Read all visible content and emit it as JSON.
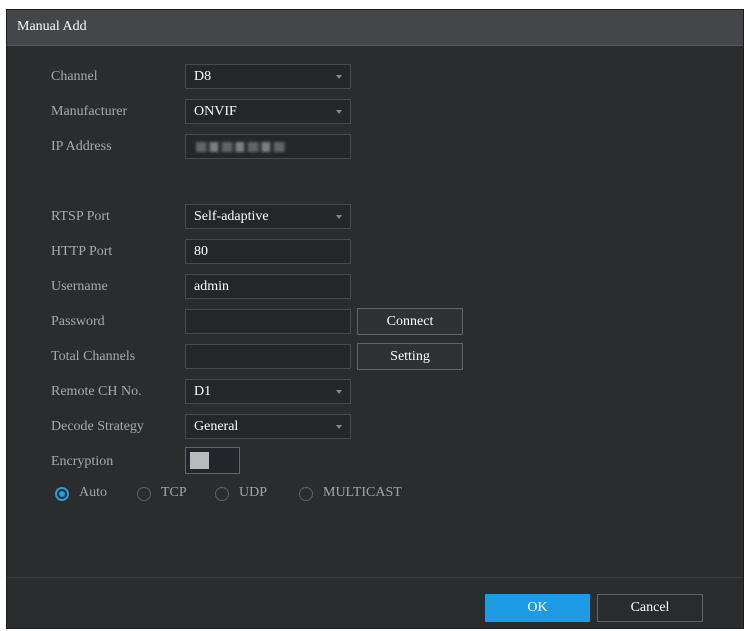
{
  "dialog": {
    "title": "Manual Add"
  },
  "form": {
    "channel": {
      "label": "Channel",
      "value": "D8"
    },
    "manufacturer": {
      "label": "Manufacturer",
      "value": "ONVIF"
    },
    "ip_address": {
      "label": "IP Address",
      "value": ""
    },
    "rtsp_port": {
      "label": "RTSP Port",
      "value": "Self-adaptive"
    },
    "http_port": {
      "label": "HTTP Port",
      "value": "80"
    },
    "username": {
      "label": "Username",
      "value": "admin"
    },
    "password": {
      "label": "Password",
      "value": ""
    },
    "total_channels": {
      "label": "Total Channels",
      "value": ""
    },
    "remote_ch_no": {
      "label": "Remote CH No.",
      "value": "D1"
    },
    "decode_strategy": {
      "label": "Decode Strategy",
      "value": "General"
    },
    "encryption": {
      "label": "Encryption",
      "enabled": false
    }
  },
  "buttons": {
    "connect": "Connect",
    "setting": "Setting",
    "ok": "OK",
    "cancel": "Cancel"
  },
  "protocol": {
    "options": [
      "Auto",
      "TCP",
      "UDP",
      "MULTICAST"
    ],
    "selected": "Auto"
  },
  "colors": {
    "accent": "#1f9be6",
    "background": "#2b2c2e",
    "titlebar": "#44464a"
  },
  "icons": {
    "dropdown": "chevron-down-icon"
  }
}
